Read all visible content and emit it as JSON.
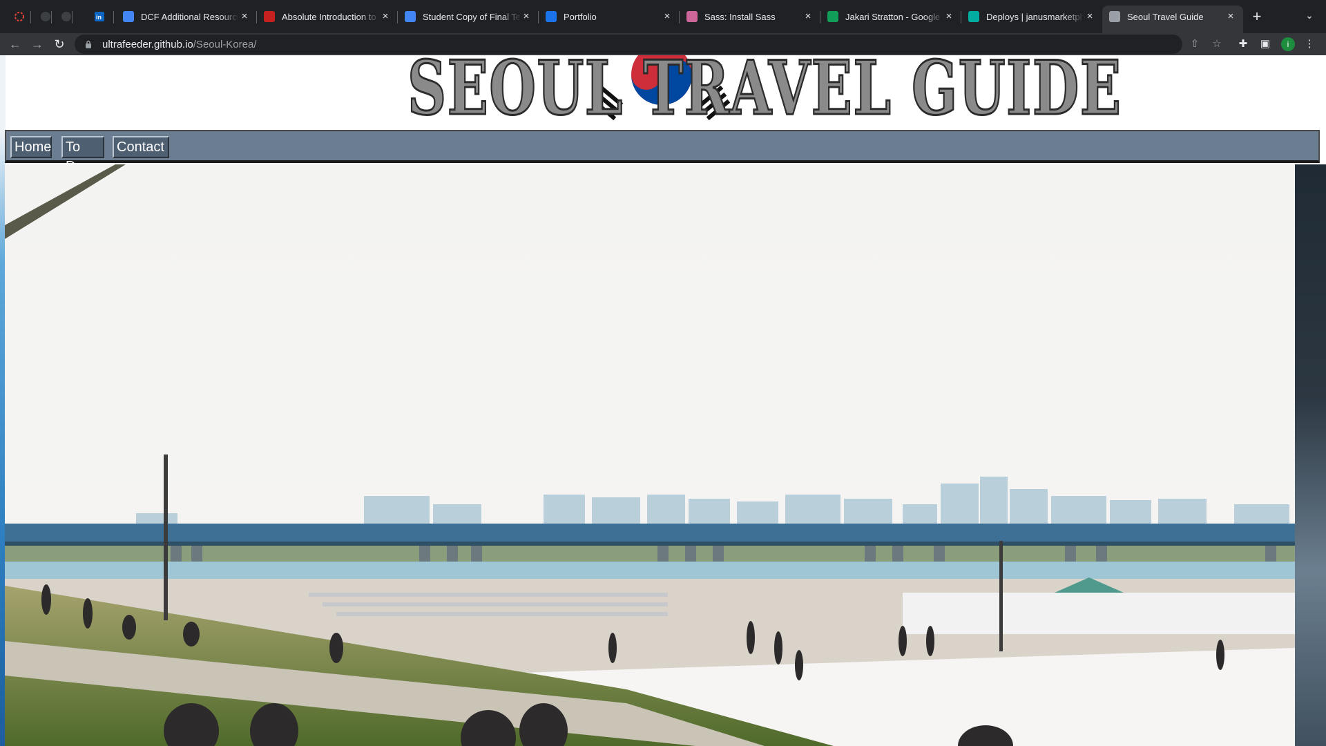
{
  "browser": {
    "tabs": [
      {
        "title": "DCF Additional Resources",
        "favicon": "doc-icon",
        "color": "#4285f4"
      },
      {
        "title": "Absolute Introduction to",
        "favicon": "course-icon",
        "color": "#c5221f"
      },
      {
        "title": "Student Copy of Final Te",
        "favicon": "doc-icon",
        "color": "#4285f4"
      },
      {
        "title": "Portfolio",
        "favicon": "jp-icon",
        "color": "#1a73e8"
      },
      {
        "title": "Sass: Install Sass",
        "favicon": "sass-icon",
        "color": "#cd6799"
      },
      {
        "title": "Jakari Stratton - Google",
        "favicon": "sheets-icon",
        "color": "#0f9d58"
      },
      {
        "title": "Deploys | janusmarketpl",
        "favicon": "netlify-icon",
        "color": "#00ad9f"
      },
      {
        "title": "Seoul Travel Guide",
        "favicon": "globe-icon",
        "color": "#9aa0a6",
        "active": true
      }
    ],
    "url_host": "ultrafeeder.github.io",
    "url_path": "/Seoul-Korea/",
    "profile_initial": "i"
  },
  "site": {
    "logo_text": "SEOUL TRAVEL GUIDE",
    "nav": [
      "Home",
      "To Do",
      "Contact"
    ]
  }
}
